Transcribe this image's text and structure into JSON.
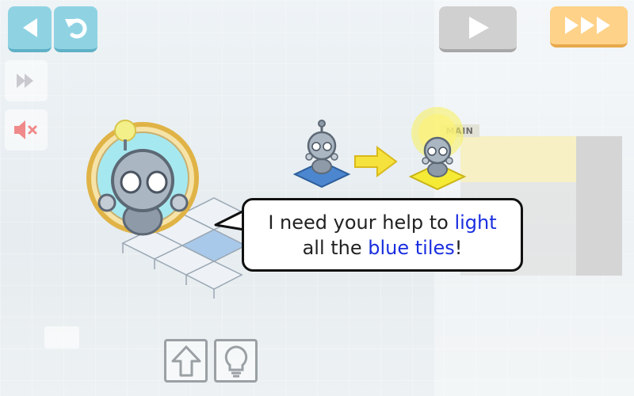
{
  "toolbar": {
    "back_icon": "back-arrow-icon",
    "undo_icon": "undo-icon",
    "play_icon": "play-icon",
    "fast_forward_icon": "fast-forward-icon"
  },
  "side": {
    "speed_icon": "step-forward-icon",
    "sound_icon": "sound-muted-icon"
  },
  "program": {
    "main_label": "MAIN"
  },
  "dialog": {
    "line1_a": "I need your help to ",
    "line1_b": "light",
    "line2_a": "all the ",
    "line2_b": "blue tiles",
    "line2_c": "!"
  },
  "bottom": {
    "command_icon": "arrow-up-icon",
    "light_icon": "lightbulb-icon"
  },
  "colors": {
    "accent_teal": "#8fd3e3",
    "accent_orange": "#ffd289",
    "highlight_blue": "#1a2ee0",
    "tile_blue": "#4b86cf",
    "tile_lit": "#f5ea35"
  }
}
